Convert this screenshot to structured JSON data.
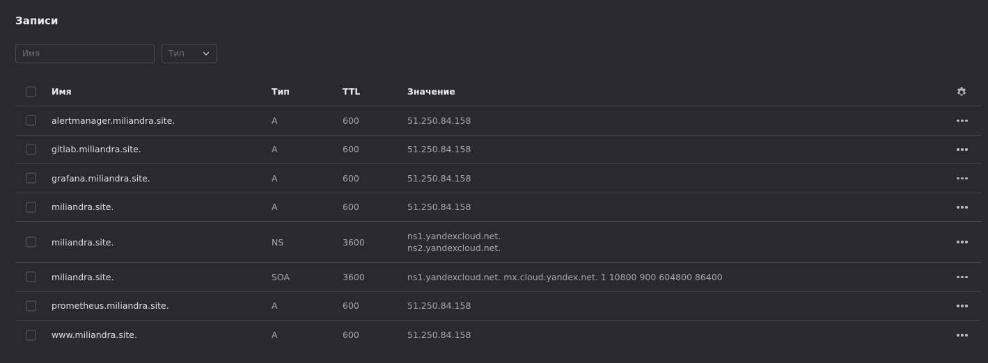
{
  "title": "Записи",
  "filters": {
    "name_placeholder": "Имя",
    "type_label": "Тип"
  },
  "table": {
    "columns": {
      "name": "Имя",
      "type": "Тип",
      "ttl": "TTL",
      "value": "Значение"
    },
    "rows": [
      {
        "name": "alertmanager.miliandra.site.",
        "type": "A",
        "ttl": "600",
        "value": [
          "51.250.84.158"
        ]
      },
      {
        "name": "gitlab.miliandra.site.",
        "type": "A",
        "ttl": "600",
        "value": [
          "51.250.84.158"
        ]
      },
      {
        "name": "grafana.miliandra.site.",
        "type": "A",
        "ttl": "600",
        "value": [
          "51.250.84.158"
        ]
      },
      {
        "name": "miliandra.site.",
        "type": "A",
        "ttl": "600",
        "value": [
          "51.250.84.158"
        ]
      },
      {
        "name": "miliandra.site.",
        "type": "NS",
        "ttl": "3600",
        "value": [
          "ns1.yandexcloud.net.",
          "ns2.yandexcloud.net."
        ]
      },
      {
        "name": "miliandra.site.",
        "type": "SOA",
        "ttl": "3600",
        "value": [
          "ns1.yandexcloud.net. mx.cloud.yandex.net. 1 10800 900 604800 86400"
        ]
      },
      {
        "name": "prometheus.miliandra.site.",
        "type": "A",
        "ttl": "600",
        "value": [
          "51.250.84.158"
        ]
      },
      {
        "name": "www.miliandra.site.",
        "type": "A",
        "ttl": "600",
        "value": [
          "51.250.84.158"
        ]
      }
    ]
  },
  "icons": {
    "settings": "gear-icon",
    "row_menu": "more-horizontal-icon",
    "dropdown": "chevron-down-icon"
  }
}
